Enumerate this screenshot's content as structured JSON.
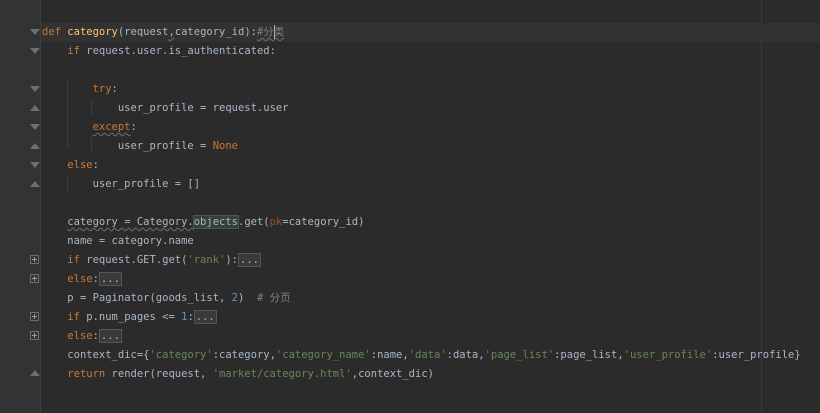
{
  "editor": {
    "lines": [
      {
        "text_kw": "def",
        "fn": "category",
        "rest": "(request",
        "sep": ",",
        "rest2": "category_id):",
        "cmt": "#分类"
      },
      {
        "indent": "    ",
        "kw": "if",
        "rest": " request.user.is_authenticated:"
      },
      {
        "blank": true
      },
      {
        "indent": "        ",
        "kw": "try",
        "rest": ":"
      },
      {
        "indent": "            ",
        "rest": "user_profile = request.user"
      },
      {
        "indent": "        ",
        "kw": "except",
        "rest": ":"
      },
      {
        "indent": "            ",
        "rest": "user_profile = ",
        "kw2": "None"
      },
      {
        "indent": "    ",
        "kw": "else",
        "rest": ":"
      },
      {
        "indent": "        ",
        "rest": "user_profile = []"
      },
      {
        "blank": true
      },
      {
        "indent": "    ",
        "rest": "category = Category.",
        "hl": "objects",
        "rest2": ".get(",
        "param": "pk",
        "rest3": "=category_id)"
      },
      {
        "indent": "    ",
        "rest": "name = category.name"
      },
      {
        "indent": "    ",
        "kw": "if",
        "rest": " request.GET.get(",
        "str": "'rank'",
        "rest2": "):",
        "fold": "..."
      },
      {
        "indent": "    ",
        "kw": "else",
        "rest": ":",
        "fold": "..."
      },
      {
        "indent": "    ",
        "rest": "p = Paginator(goods_list, ",
        "num": "2",
        "rest2": ")  ",
        "cmt": "# 分页"
      },
      {
        "indent": "    ",
        "kw": "if",
        "rest": " p.num_pages <= ",
        "num": "1",
        "rest2": ":",
        "fold": "..."
      },
      {
        "indent": "    ",
        "kw": "else",
        "rest": ":",
        "fold": "..."
      },
      {
        "indent": "    ",
        "ctx": true
      },
      {
        "indent": "    ",
        "kw": "return",
        "rest": " render(request, ",
        "str": "'market/category.html'",
        "rest2": ",context_dic)"
      }
    ],
    "ctx_line": {
      "a": "context_dic={",
      "s1": "'category'",
      "c1": ":category,",
      "s2": "'category_name'",
      "c2": ":name,",
      "s3": "'data'",
      "c3": ":data,",
      "s4": "'page_list'",
      "c4": ":page_list,",
      "s5": "'user_profile'",
      "c5": ":user_profile}"
    }
  }
}
